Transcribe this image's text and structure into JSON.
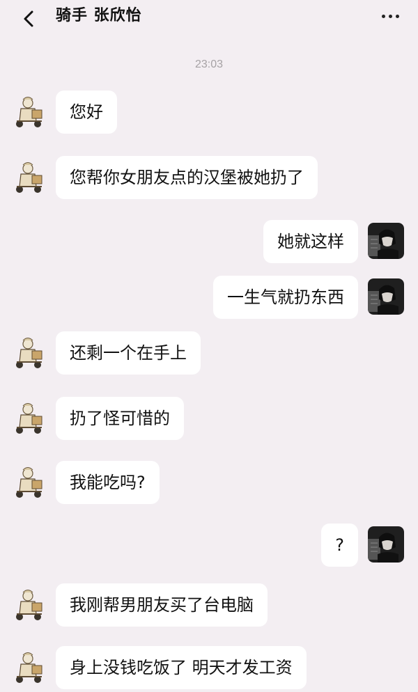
{
  "header": {
    "title": "骑手 张欣怡"
  },
  "timestamp": "23:03",
  "messages": [
    {
      "side": "left",
      "text": "您好"
    },
    {
      "side": "left",
      "text": "您帮你女朋友点的汉堡被她扔了"
    },
    {
      "side": "right",
      "text": "她就这样"
    },
    {
      "side": "right",
      "text": "一生气就扔东西"
    },
    {
      "side": "left",
      "text": "还剩一个在手上"
    },
    {
      "side": "left",
      "text": "扔了怪可惜的"
    },
    {
      "side": "left",
      "text": "我能吃吗?"
    },
    {
      "side": "right",
      "text": "?"
    },
    {
      "side": "left",
      "text": "我刚帮男朋友买了台电脑"
    },
    {
      "side": "left",
      "text": "身上没钱吃饭了 明天才发工资"
    }
  ],
  "icons": {
    "back": "chevron-left-icon",
    "more": "more-dots-icon",
    "rider_avatar": "rider-avatar",
    "user_avatar": "user-avatar"
  },
  "colors": {
    "background": "#f3eef2",
    "bubble": "#ffffff",
    "timestamp": "#a6a2a5"
  }
}
